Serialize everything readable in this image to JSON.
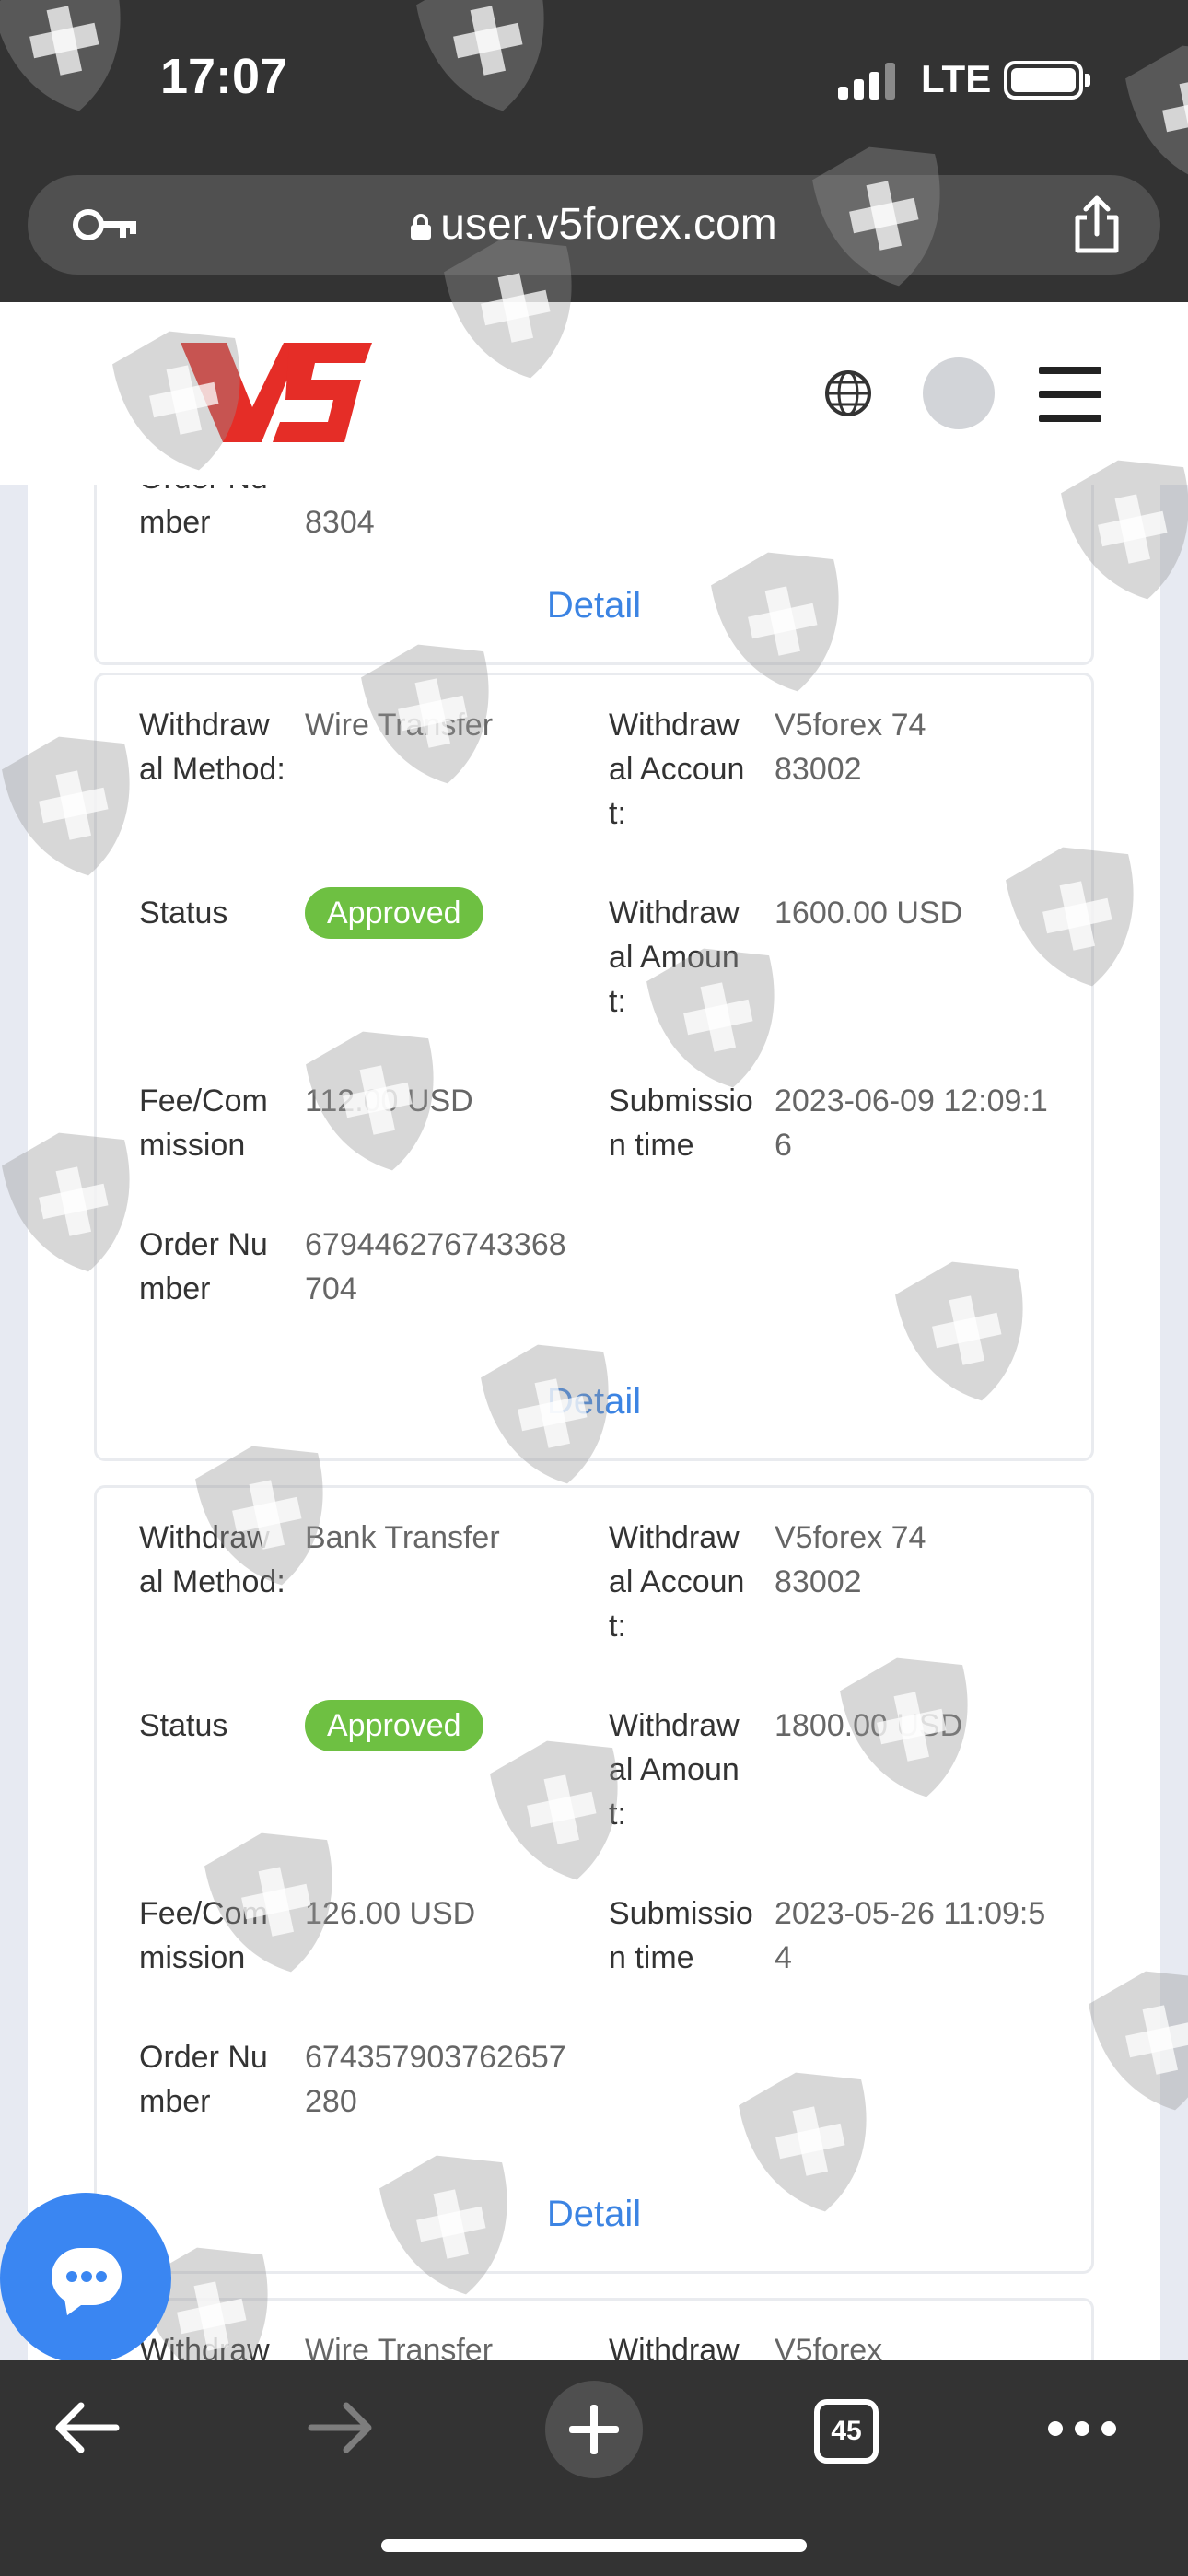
{
  "status_bar": {
    "time": "17:07",
    "network": "LTE"
  },
  "browser": {
    "url": "user.v5forex.com",
    "tab_count": "45"
  },
  "site": {
    "logo_text": "V5"
  },
  "labels": {
    "method": "Withdrawal Method:",
    "account": "Withdrawal Account:",
    "status": "Status",
    "amount": "Withdrawal Amount:",
    "fee": "Fee/Commission",
    "time": "Submission time",
    "order": "Order Number"
  },
  "cards": [
    {
      "order_tail": "8304",
      "detail": "Detail"
    },
    {
      "method": "Wire Transfer",
      "account": "V5forex 7483002",
      "status": "Approved",
      "amount": "1600.00 USD",
      "fee": "112.00 USD",
      "time": "2023-06-09 12:09:16",
      "order": "679446276743368704",
      "detail": "Detail"
    },
    {
      "method": "Bank Transfer",
      "account": "V5forex 7483002",
      "status": "Approved",
      "amount": "1800.00 USD",
      "fee": "126.00 USD",
      "time": "2023-05-26 11:09:54",
      "order": "674357903762657280",
      "detail": "Detail"
    },
    {
      "method": "Wire Transfer",
      "account": "V5forex"
    }
  ],
  "colors": {
    "approved": "#6ec042",
    "link": "#3c84e3",
    "chat_button": "#3a86f2",
    "logo_red": "#e52d27",
    "browser_chrome": "#333333"
  },
  "icons": [
    "key-icon",
    "lock-icon",
    "share-icon",
    "globe-icon",
    "menu-icon",
    "chat-icon",
    "back-icon",
    "forward-icon",
    "plus-icon",
    "tabs-icon",
    "more-icon"
  ]
}
